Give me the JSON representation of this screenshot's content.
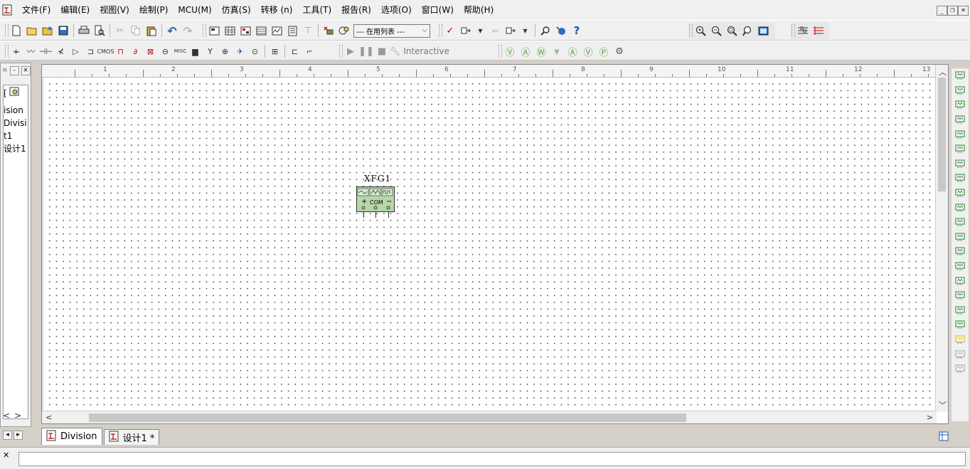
{
  "menu": {
    "items": [
      "文件(F)",
      "编辑(E)",
      "视图(V)",
      "绘制(P)",
      "MCU(M)",
      "仿真(S)",
      "转移 (n)",
      "工具(T)",
      "报告(R)",
      "选项(O)",
      "窗口(W)",
      "帮助(H)"
    ]
  },
  "window_controls": {
    "minimize": "_",
    "restore": "❐",
    "close": "×"
  },
  "toolbar": {
    "in_use_list": "--- 在用列表 ---",
    "interactive": "Interactive"
  },
  "design_toolbox": {
    "close": "×",
    "tree": [
      "ision",
      "Divisi",
      "t1",
      "设计1"
    ],
    "scroll_left": "<",
    "scroll_right": ">"
  },
  "ruler": {
    "ticks": [
      "1",
      "2",
      "3",
      "4",
      "5",
      "6",
      "7",
      "8",
      "9",
      "10",
      "11",
      "12",
      "13"
    ]
  },
  "component": {
    "ref": "XFG1",
    "pins": {
      "plus": "+",
      "com": "COM",
      "minus": "−"
    }
  },
  "sheet_tabs": [
    "Division",
    "设计1 *"
  ],
  "colors": {
    "component_fill": "#b7d7a8",
    "accent_blue": "#2a5db0"
  }
}
